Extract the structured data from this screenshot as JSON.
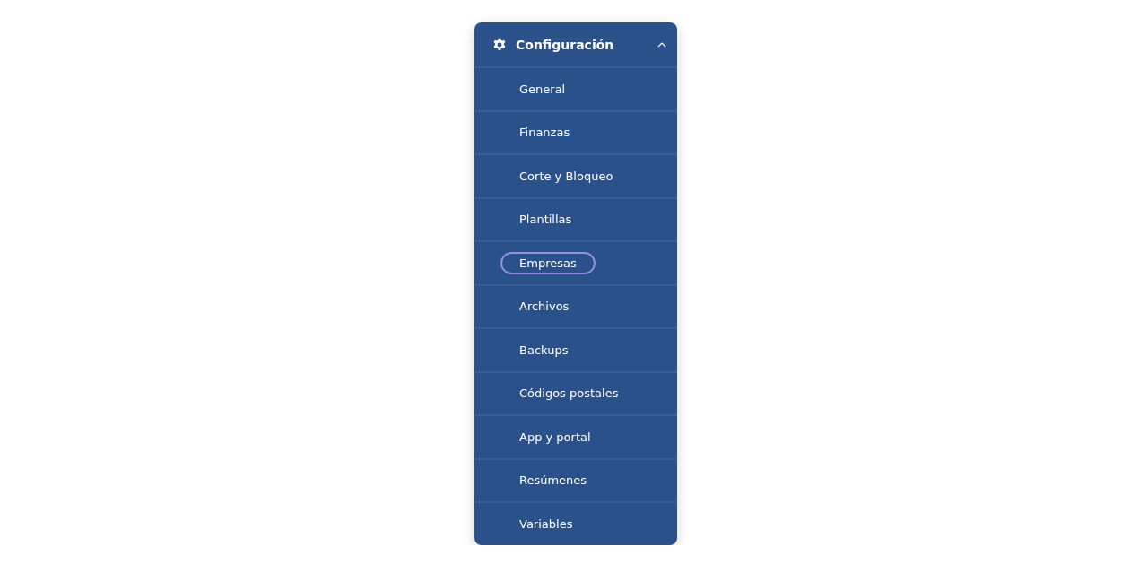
{
  "menu": {
    "title": "Configuración",
    "expanded": true,
    "items": [
      {
        "label": "General",
        "selected": false
      },
      {
        "label": "Finanzas",
        "selected": false
      },
      {
        "label": "Corte y Bloqueo",
        "selected": false
      },
      {
        "label": "Plantillas",
        "selected": false
      },
      {
        "label": "Empresas",
        "selected": true
      },
      {
        "label": "Archivos",
        "selected": false
      },
      {
        "label": "Backups",
        "selected": false
      },
      {
        "label": "Códigos postales",
        "selected": false
      },
      {
        "label": "App y portal",
        "selected": false
      },
      {
        "label": "Resúmenes",
        "selected": false
      },
      {
        "label": "Variables",
        "selected": false
      }
    ]
  }
}
